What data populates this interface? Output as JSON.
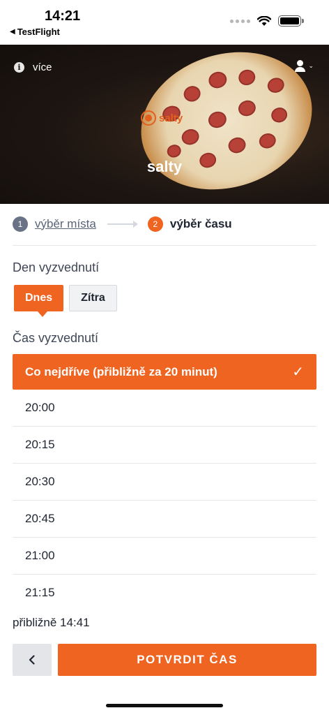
{
  "status_bar": {
    "time": "14:21",
    "back_app": "TestFlight"
  },
  "hero": {
    "info_label": "více",
    "logo_text": "salty",
    "title": "salty"
  },
  "stepper": {
    "step1_number": "1",
    "step1_label": "výběr místa",
    "step2_number": "2",
    "step2_label": "výběr času"
  },
  "day_section": {
    "label": "Den vyzvednutí",
    "options": [
      "Dnes",
      "Zítra"
    ],
    "selected": "Dnes"
  },
  "time_section": {
    "label": "Čas vyzvednutí",
    "selected": "Co nejdříve (přibližně za 20 minut)",
    "times": [
      "20:00",
      "20:15",
      "20:30",
      "20:45",
      "21:00",
      "21:15"
    ]
  },
  "approx_time": "přibližně 14:41",
  "footer": {
    "back_icon": "chevron-left-icon",
    "confirm_label": "POTVRDIT ČAS"
  },
  "colors": {
    "accent": "#ef6420",
    "hero_bg": "#1c1511",
    "text": "#1e2430"
  }
}
